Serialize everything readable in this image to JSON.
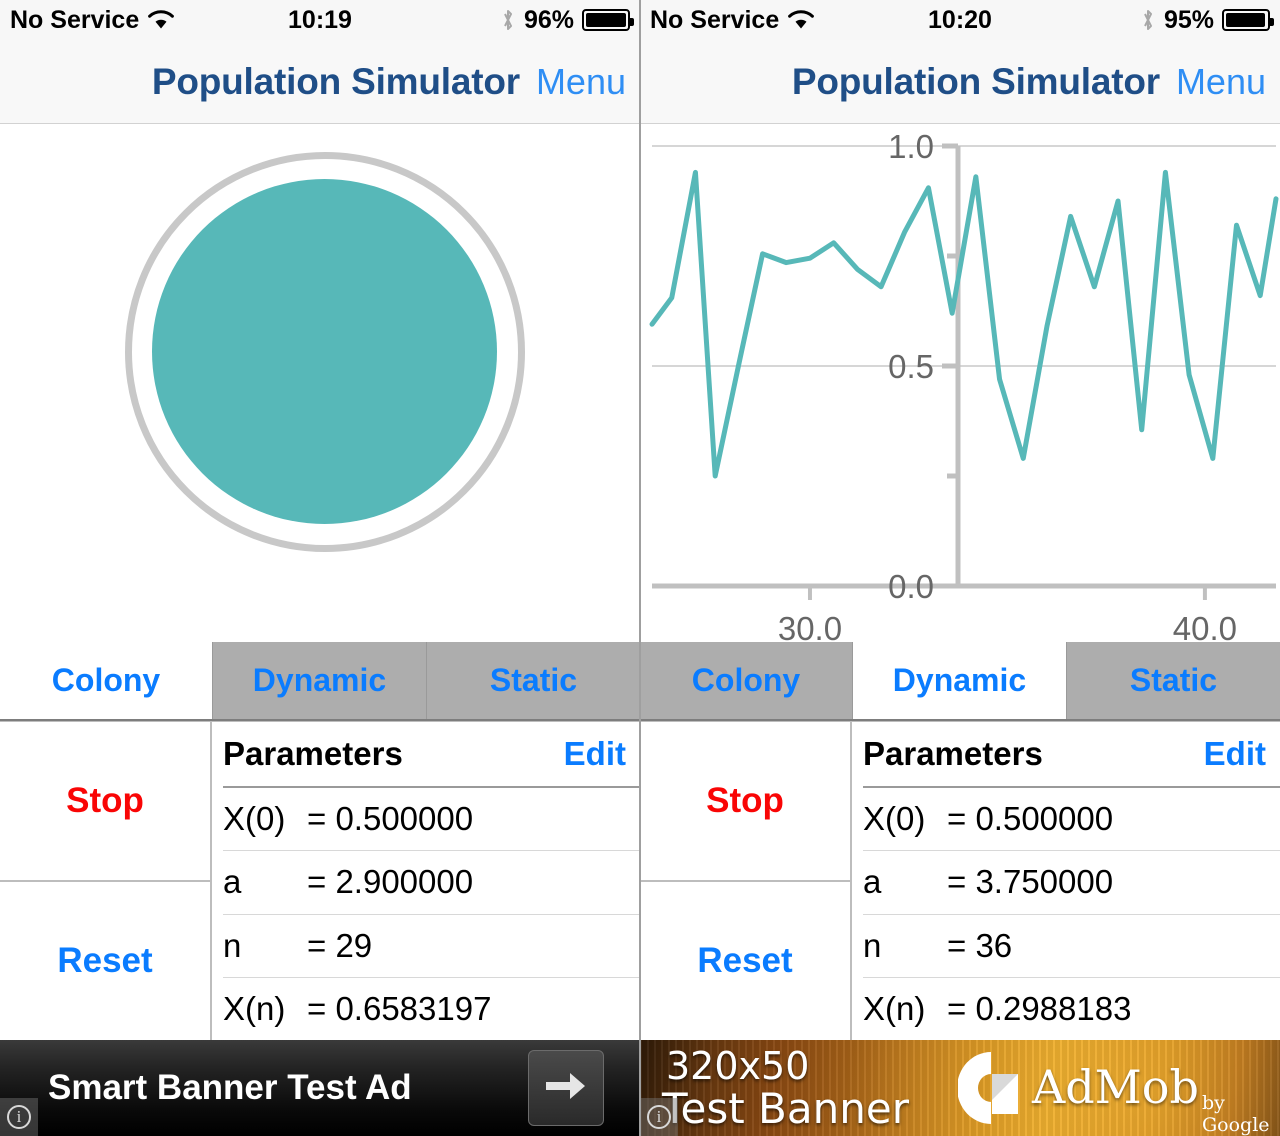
{
  "panels": [
    {
      "status": {
        "carrier": "No Service",
        "wifi_icon": "wifi-icon",
        "time": "10:19",
        "bluetooth_icon": "bluetooth-icon",
        "battery_pct": "96%",
        "battery_level": 96
      },
      "nav": {
        "title": "Population Simulator",
        "menu": "Menu"
      },
      "view": "colony",
      "colony": {
        "fill_color": "#57b8b8",
        "ring_color": "#c8c8c8"
      },
      "tabs": [
        {
          "label": "Colony",
          "selected": true
        },
        {
          "label": "Dynamic",
          "selected": false
        },
        {
          "label": "Static",
          "selected": false
        }
      ],
      "actions": {
        "stop": "Stop",
        "reset": "Reset"
      },
      "parameters": {
        "title": "Parameters",
        "edit": "Edit",
        "rows": [
          {
            "key": "X(0)",
            "value": "= 0.500000"
          },
          {
            "key": "a",
            "value": "= 2.900000"
          },
          {
            "key": "n",
            "value": "= 29"
          },
          {
            "key": "X(n)",
            "value": "= 0.6583197"
          }
        ]
      },
      "ad": {
        "type": "smart-banner",
        "text": "Smart Banner Test Ad",
        "arrow_icon": "arrow-right-icon",
        "info_icon": "info-icon"
      }
    },
    {
      "status": {
        "carrier": "No Service",
        "wifi_icon": "wifi-icon",
        "time": "10:20",
        "bluetooth_icon": "bluetooth-icon",
        "battery_pct": "95%",
        "battery_level": 95
      },
      "nav": {
        "title": "Population Simulator",
        "menu": "Menu"
      },
      "view": "chart",
      "tabs": [
        {
          "label": "Colony",
          "selected": false
        },
        {
          "label": "Dynamic",
          "selected": true
        },
        {
          "label": "Static",
          "selected": false
        }
      ],
      "actions": {
        "stop": "Stop",
        "reset": "Reset"
      },
      "parameters": {
        "title": "Parameters",
        "edit": "Edit",
        "rows": [
          {
            "key": "X(0)",
            "value": "= 0.500000"
          },
          {
            "key": "a",
            "value": "= 3.750000"
          },
          {
            "key": "n",
            "value": "= 36"
          },
          {
            "key": "X(n)",
            "value": "= 0.2988183"
          }
        ]
      },
      "ad": {
        "type": "admob-test-banner",
        "size_text": "320x50",
        "banner_text": "Test Banner",
        "brand": "AdMob",
        "brand_sub": "by Google",
        "logo_icon": "admob-logo-icon",
        "info_icon": "info-icon"
      }
    }
  ],
  "chart_data": {
    "type": "line",
    "title": "",
    "xlabel": "",
    "ylabel": "",
    "xlim": [
      26.0,
      41.8
    ],
    "ylim": [
      0.0,
      1.0
    ],
    "grid": true,
    "legend": null,
    "line_color": "#57b8b8",
    "line_width": 5,
    "axis_color": "#c0c0c0",
    "tick_label_color": "#666666",
    "y_ticks": [
      0.0,
      0.5,
      1.0
    ],
    "y_tick_labels": [
      "0.0",
      "0.5",
      "1.0"
    ],
    "y_minor_ticks": [
      0.25,
      0.75
    ],
    "x_ticks": [
      30.0,
      40.0
    ],
    "x_tick_labels": [
      "30.0",
      "40.0"
    ],
    "x_minor_ticks": [
      45.0
    ],
    "series": [
      {
        "name": "X(n)",
        "x": [
          26.0,
          26.5,
          27.1,
          27.6,
          28.2,
          28.8,
          29.4,
          30.0,
          30.6,
          31.2,
          31.8,
          32.4,
          33.0,
          33.6,
          34.2,
          34.8,
          35.4,
          36.0,
          36.6,
          37.2,
          37.8,
          38.4,
          39.0,
          39.6,
          40.2,
          40.8,
          41.4,
          41.8
        ],
        "y": [
          0.595,
          0.655,
          0.94,
          0.25,
          0.505,
          0.755,
          0.735,
          0.745,
          0.78,
          0.72,
          0.68,
          0.805,
          0.905,
          0.62,
          0.93,
          0.47,
          0.29,
          0.59,
          0.84,
          0.68,
          0.875,
          0.355,
          0.94,
          0.48,
          0.29,
          0.82,
          0.66,
          0.88
        ]
      }
    ]
  }
}
